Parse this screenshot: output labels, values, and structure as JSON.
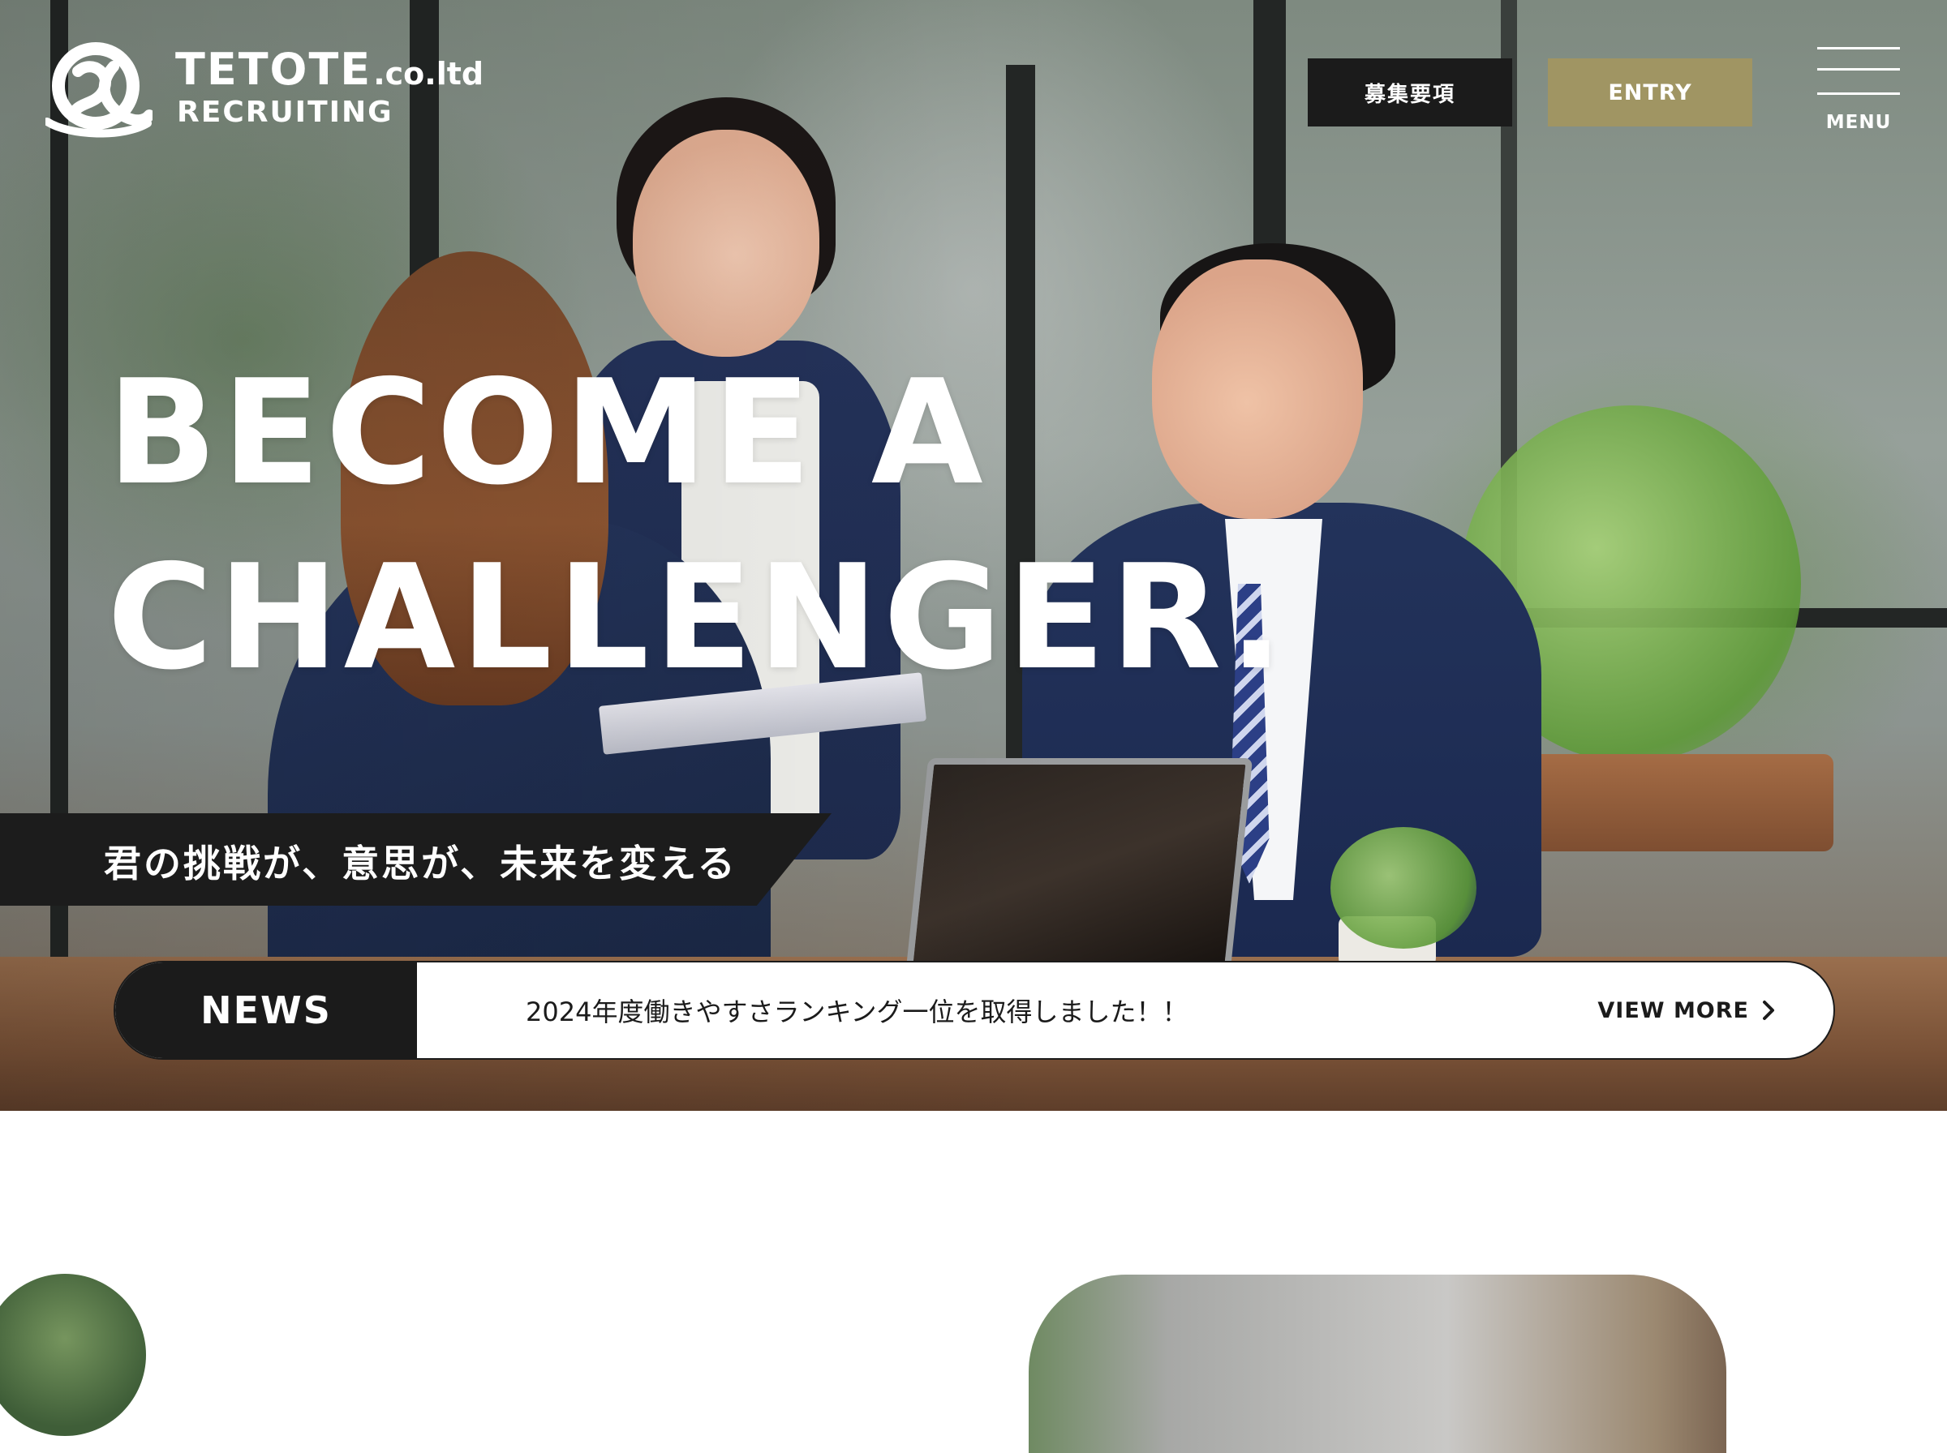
{
  "header": {
    "logo": {
      "name": "TETOTE",
      "suffix": ".co.ltd",
      "sub": "RECRUITING"
    },
    "nav": {
      "recruit_label": "募集要項",
      "entry_label": "ENTRY",
      "menu_label": "MENU"
    }
  },
  "hero": {
    "headline_line1": "BECOME A",
    "headline_line2": "CHALLENGER.",
    "tagline": "君の挑戦が、意思が、未来を変える",
    "image": "business-meeting-photo"
  },
  "news": {
    "label": "NEWS",
    "headline": "2024年度働きやすさランキング一位を取得しました！！",
    "more_label": "VIEW MORE",
    "more_icon": "chevron-right-icon"
  },
  "colors": {
    "dark": "#1b1b1b",
    "accent_gold": "#a09563",
    "white": "#ffffff"
  }
}
